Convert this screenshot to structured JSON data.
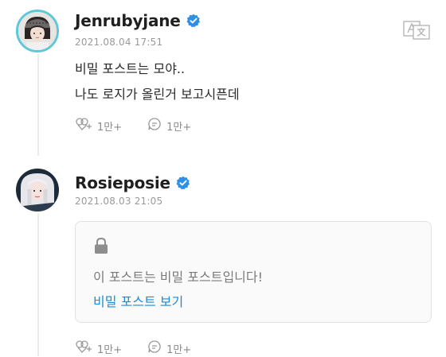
{
  "posts": [
    {
      "author": "Jenrubyjane",
      "timestamp": "2021.08.04 17:51",
      "lines": [
        "비밀 포스트는 모야..",
        "나도 로지가 올린거 보고시픈데"
      ],
      "likes": "1만+",
      "comments": "1만+"
    },
    {
      "author": "Rosieposie",
      "timestamp": "2021.08.03 21:05",
      "locked_message": "이 포스트는 비밀 포스트입니다!",
      "view_link": "비밀 포스트 보기",
      "likes": "1만+",
      "comments": "1만+"
    }
  ],
  "colors": {
    "verified": "#2d8fe6",
    "link": "#1f8ad6",
    "muted": "#8a8a8a"
  },
  "icons": [
    "verified-badge-icon",
    "translate-icon",
    "lock-icon",
    "like-icon",
    "comment-icon"
  ]
}
